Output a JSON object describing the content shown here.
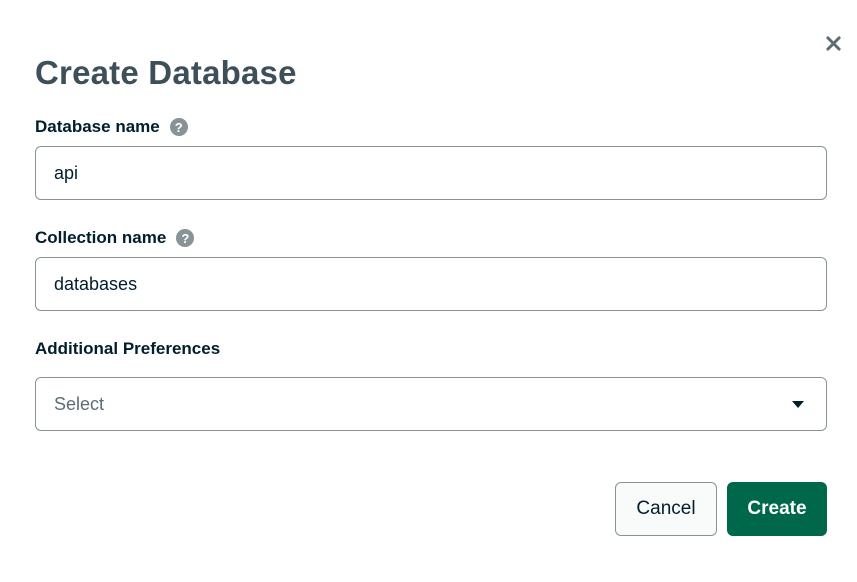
{
  "dialog": {
    "title": "Create Database",
    "close_icon": "close-icon"
  },
  "fields": {
    "database_name": {
      "label": "Database name",
      "value": "api",
      "help_icon": "question-circle-icon",
      "help_glyph": "?"
    },
    "collection_name": {
      "label": "Collection name",
      "value": "databases",
      "help_icon": "question-circle-icon",
      "help_glyph": "?"
    },
    "additional_preferences": {
      "label": "Additional Preferences",
      "selected": "Select",
      "icon": "caret-down-icon"
    }
  },
  "actions": {
    "cancel_label": "Cancel",
    "create_label": "Create"
  },
  "colors": {
    "title": "#3d4f58",
    "primary_button": "#00684a",
    "border": "#889397"
  }
}
